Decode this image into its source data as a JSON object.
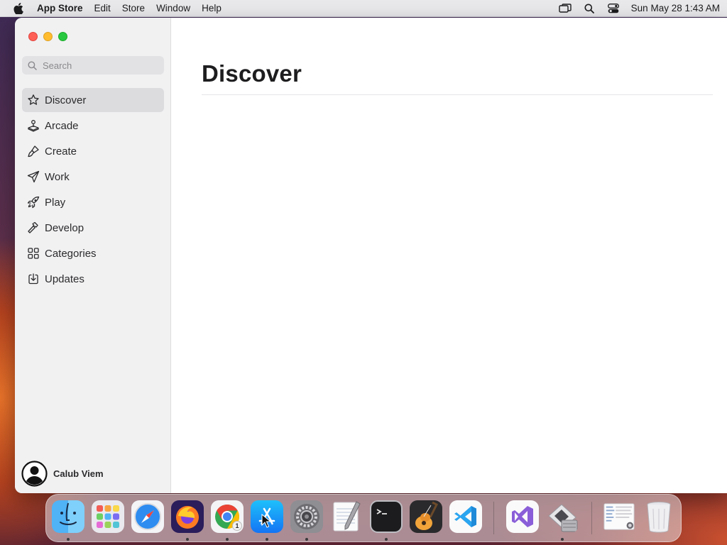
{
  "menubar": {
    "app_name": "App Store",
    "items": [
      "Edit",
      "Store",
      "Window",
      "Help"
    ],
    "clock": "Sun May 28  1:43 AM",
    "icons": [
      "apple-icon",
      "screen-mirroring-icon",
      "spotlight-search-icon",
      "control-center-icon"
    ]
  },
  "window": {
    "search": {
      "placeholder": "Search",
      "value": ""
    },
    "sidebar": {
      "items": [
        {
          "label": "Discover",
          "icon": "star-icon",
          "selected": true
        },
        {
          "label": "Arcade",
          "icon": "joystick-icon",
          "selected": false
        },
        {
          "label": "Create",
          "icon": "brush-icon",
          "selected": false
        },
        {
          "label": "Work",
          "icon": "paper-plane-icon",
          "selected": false
        },
        {
          "label": "Play",
          "icon": "rocket-icon",
          "selected": false
        },
        {
          "label": "Develop",
          "icon": "hammer-icon",
          "selected": false
        },
        {
          "label": "Categories",
          "icon": "grid-icon",
          "selected": false
        },
        {
          "label": "Updates",
          "icon": "download-icon",
          "selected": false
        }
      ]
    },
    "user": {
      "name": "Calub Viem"
    },
    "main": {
      "title": "Discover"
    }
  },
  "dock": {
    "apps": [
      {
        "name": "finder",
        "running": true
      },
      {
        "name": "launchpad",
        "running": false
      },
      {
        "name": "safari",
        "running": false
      },
      {
        "name": "firefox",
        "running": true
      },
      {
        "name": "chrome",
        "running": true,
        "badge": "1"
      },
      {
        "name": "app-store",
        "running": true
      },
      {
        "name": "system-settings",
        "running": true
      },
      {
        "name": "textedit",
        "running": false
      },
      {
        "name": "terminal",
        "running": true
      },
      {
        "name": "garageband",
        "running": false
      },
      {
        "name": "visual-studio-code",
        "running": false
      },
      {
        "name": "visual-studio",
        "running": false
      },
      {
        "name": "boot-camp-assistant",
        "running": true
      },
      {
        "name": "document-stack",
        "running": false
      },
      {
        "name": "trash",
        "running": false
      }
    ]
  }
}
